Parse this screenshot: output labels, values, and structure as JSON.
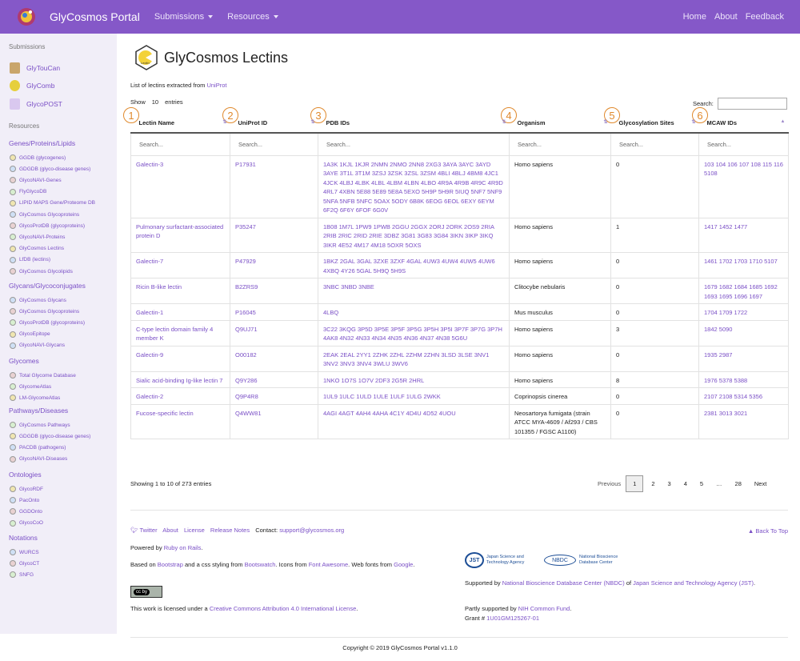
{
  "navbar": {
    "brand": "GlyCosmos Portal",
    "submissions": "Submissions",
    "resources": "Resources",
    "home": "Home",
    "about": "About",
    "feedback": "Feedback"
  },
  "sidebar": {
    "submissions_heading": "Submissions",
    "submission_items": [
      "GlyTouCan",
      "GlyComb",
      "GlycoPOST"
    ],
    "resources_heading": "Resources",
    "categories": [
      {
        "title": "Genes/Proteins/Lipids",
        "items": [
          "GGDB (glycogenes)",
          "GDGDB (glyco-disease genes)",
          "GlycoNAVI-Genes",
          "FlyGlycoDB",
          "LIPID MAPS Gene/Proteome DB",
          "GlyCosmos Glycoproteins",
          "GlycoProtDB (glycoproteins)",
          "GlycoNAVI-Proteins",
          "GlyCosmos Lectins",
          "LfDB (lectins)",
          "GlyCosmos Glycolipids"
        ]
      },
      {
        "title": "Glycans/Glycoconjugates",
        "items": [
          "GlyCosmos Glycans",
          "GlyCosmos Glycoproteins",
          "GlycoProtDB (glycoproteins)",
          "GlycoEpitope",
          "GlycoNAVI-Glycans"
        ]
      },
      {
        "title": "Glycomes",
        "items": [
          "Total Glycome Database",
          "GlycomeAtlas",
          "LM-GlycomeAtlas"
        ]
      },
      {
        "title": "Pathways/Diseases",
        "items": [
          "GlyCosmos Pathways",
          "GDGDB (glyco-disease genes)",
          "PACDB (pathogens)",
          "GlycoNAVI-Diseases"
        ]
      },
      {
        "title": "Ontologies",
        "items": [
          "GlycoRDF",
          "PacOnto",
          "GGDOnto",
          "GlycoCoO"
        ]
      },
      {
        "title": "Notations",
        "items": [
          "WURCS",
          "GlycoCT",
          "SNFG"
        ]
      }
    ]
  },
  "main": {
    "title": "GlyCosmos Lectins",
    "subtitle_prefix": "List of lectins extracted from",
    "subtitle_link": "UniProt",
    "show_label": "Show",
    "show_value": "10",
    "entries_label": "entries",
    "search_label": "Search:",
    "annotations": [
      "1",
      "2",
      "3",
      "4",
      "5",
      "6"
    ],
    "columns": [
      "Lectin Name",
      "UniProt ID",
      "PDB IDs",
      "Organism",
      "Glycosylation Sites",
      "MCAW IDs"
    ],
    "filter_placeholder": "Search...",
    "rows": [
      [
        "Galectin-3",
        "P17931",
        "1A3K 1KJL 1KJR 2NMN 2NMO 2NN8 2XG3 3AYA 3AYC 3AYD 3AYE 3T1L 3T1M 3ZSJ 3ZSK 3ZSL 3ZSM 4BLI 4BLJ 4BM8 4JC1 4JCK 4LBJ 4LBK 4LBL 4LBM 4LBN 4LBO 4R9A 4R9B 4R9C 4R9D 4RL7 4XBN 5E88 5E89 5E8A 5EXO 5H9P 5H9R 5IUQ 5NF7 5NF9 5NFA 5NFB 5NFC 5OAX 5ODY 6B8K 6EOG 6EOL 6EXY 6EYM 6F2Q 6F6Y 6FOF 6G0V",
        "Homo sapiens",
        "0",
        "103 104 106 107 108 115 116 5108"
      ],
      [
        "Pulmonary surfactant-associated protein D",
        "P35247",
        "1B08 1M7L 1PW9 1PWB 2GGU 2GGX 2ORJ 2ORK 2OS9 2RIA 2RIB 2RIC 2RID 2RIE 3DBZ 3G81 3G83 3G84 3IKN 3IKP 3IKQ 3IKR 4E52 4M17 4M18 5OXR 5OXS",
        "Homo sapiens",
        "1",
        "1417 1452 1477"
      ],
      [
        "Galectin-7",
        "P47929",
        "1BKZ 2GAL 3GAL 3ZXE 3ZXF 4GAL 4UW3 4UW4 4UW5 4UW6 4XBQ 4Y26 5GAL 5H9Q 5H9S",
        "Homo sapiens",
        "0",
        "1461 1702 1703 1710 5107"
      ],
      [
        "Ricin B-like lectin",
        "B2ZRS9",
        "3NBC 3NBD 3NBE",
        "Clitocybe nebularis",
        "0",
        "1679 1682 1684 1685 1692 1693 1695 1696 1697"
      ],
      [
        "Galectin-1",
        "P16045",
        "4LBQ",
        "Mus musculus",
        "0",
        "1704 1709 1722"
      ],
      [
        "C-type lectin domain family 4 member K",
        "Q9UJ71",
        "3C22 3KQG 3P5D 3P5E 3P5F 3P5G 3P5H 3P5I 3P7F 3P7G 3P7H 4AK8 4N32 4N33 4N34 4N35 4N36 4N37 4N38 5G6U",
        "Homo sapiens",
        "3",
        "1842 5090"
      ],
      [
        "Galectin-9",
        "O00182",
        "2EAK 2EAL 2YY1 2ZHK 2ZHL 2ZHM 2ZHN 3LSD 3LSE 3NV1 3NV2 3NV3 3NV4 3WLU 3WV6",
        "Homo sapiens",
        "0",
        "1935 2987"
      ],
      [
        "Sialic acid-binding Ig-like lectin 7",
        "Q9Y286",
        "1NKO 1O7S 1O7V 2DF3 2G5R 2HRL",
        "Homo sapiens",
        "8",
        "1976 5378 5388"
      ],
      [
        "Galectin-2",
        "Q9P4R8",
        "1UL9 1ULC 1ULD 1ULE 1ULF 1ULG 2WKK",
        "Coprinopsis cinerea",
        "0",
        "2107 2108 5314 5356"
      ],
      [
        "Fucose-specific lectin",
        "Q4WW81",
        "4AGI 4AGT 4AH4 4AHA 4C1Y 4D4U 4D52 4UOU",
        "Neosartorya fumigata (strain ATCC MYA-4609 / Af293 / CBS 101355 / FGSC A1100)",
        "0",
        "2381 3013 3021"
      ]
    ],
    "showing_text": "Showing 1 to 10 of 273 entries",
    "pager": {
      "previous": "Previous",
      "pages": [
        "1",
        "2",
        "3",
        "4",
        "5",
        "…",
        "28"
      ],
      "next": "Next"
    }
  },
  "footer": {
    "twitter": "Twitter",
    "about": "About",
    "license": "License",
    "release_notes": "Release Notes",
    "contact_label": "Contact:",
    "contact_email": "support@glycosmos.org",
    "back_to_top": "Back To Top",
    "powered_by": "Powered by",
    "rails": "Ruby on Rails",
    "based_on": "Based on",
    "bootstrap": "Bootstrap",
    "styling": "and a css styling from",
    "bootswatch": "Bootswatch",
    "icons_from": ". Icons from",
    "font_awesome": "Font Awesome",
    "web_fonts": ". Web fonts from",
    "google": "Google",
    "license_text": "This work is licensed under a",
    "cc_license": "Creative Commons Attribution 4.0 International License",
    "jst_logo": "JST",
    "jst_name": "Japan Science and Technology Agency",
    "nbdc_logo": "NBDC",
    "nbdc_name": "National Bioscience Database Center",
    "supported_by": "Supported by",
    "nbdc_full": "National Bioscience Database Center (NBDC)",
    "of": "of",
    "jst_full": "Japan Science and Technology Agency (JST)",
    "partly": "Partly supported by",
    "nih": "NIH Common Fund",
    "grant_label": "Grant #",
    "grant": "1U01GM125267-01",
    "cc_badge": "cc  by",
    "copyright": "Copyright © 2019   GlyCosmos Portal v1.1.0"
  },
  "colors": {
    "navbar": "#8558c8",
    "link": "#7a4fc6",
    "annotation": "#e08a2e",
    "sidebar": "#f1eef8"
  }
}
